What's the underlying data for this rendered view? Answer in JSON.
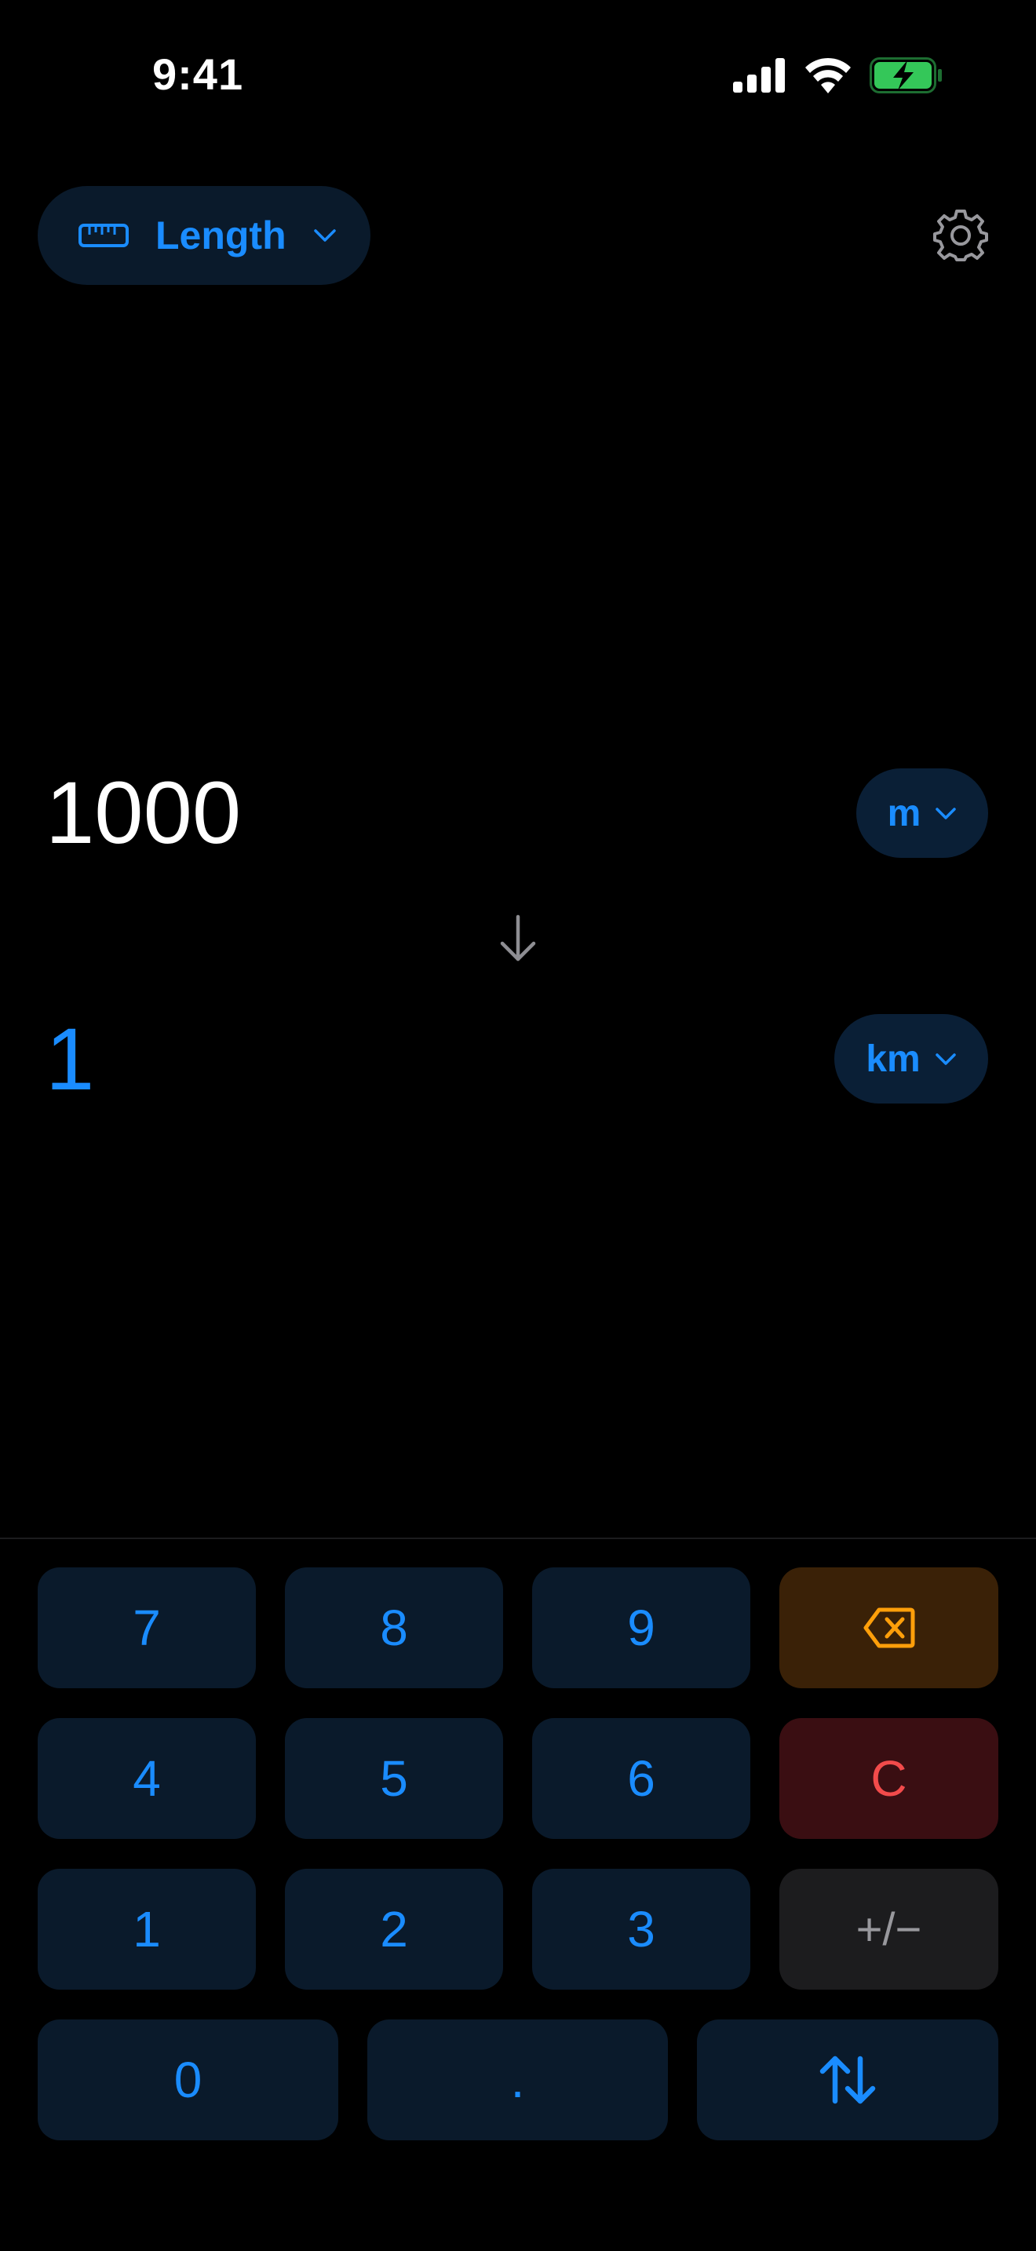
{
  "status_bar": {
    "time": "9:41"
  },
  "header": {
    "category_label": "Length",
    "category_icon": "ruler-icon",
    "settings_icon": "gear-icon"
  },
  "converter": {
    "input_value": "1000",
    "from_unit": "m",
    "output_value": "1",
    "to_unit": "km"
  },
  "keypad": {
    "row1": [
      "7",
      "8",
      "9"
    ],
    "row2": [
      "4",
      "5",
      "6"
    ],
    "row3": [
      "1",
      "2",
      "3"
    ],
    "row4": [
      "0",
      "."
    ],
    "clear_label": "C",
    "sign_label": "+/−"
  },
  "colors": {
    "accent": "#1a8cff",
    "background": "#000000",
    "key_background": "#0a1a2b",
    "delete_icon": "#ff9f0a",
    "clear_text": "#f24b4b",
    "battery": "#34c759"
  }
}
